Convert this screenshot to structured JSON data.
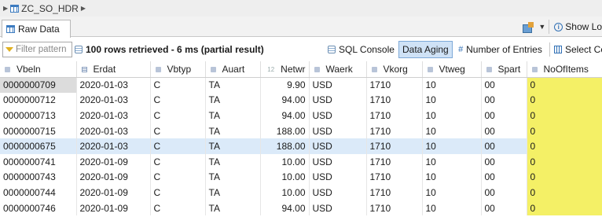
{
  "breadcrumb": {
    "table_name": "ZC_SO_HDR"
  },
  "tabs": [
    {
      "label": "Raw Data"
    }
  ],
  "topright": {
    "show_label": "Show Lo"
  },
  "toolbar": {
    "filter_placeholder": "Filter pattern",
    "status_text": "100 rows retrieved - 6 ms (partial result)",
    "sql_console": "SQL Console",
    "data_aging": "Data Aging",
    "number_of_entries": "Number of Entries",
    "select_columns": "Select Co"
  },
  "columns": [
    "Vbeln",
    "Erdat",
    "Vbtyp",
    "Auart",
    "Netwr",
    "Waerk",
    "Vkorg",
    "Vtweg",
    "Spart",
    "NoOfItems"
  ],
  "rows": [
    [
      "0000000709",
      "2020-01-03",
      "C",
      "TA",
      "9.90",
      "USD",
      "1710",
      "10",
      "00",
      "0"
    ],
    [
      "0000000712",
      "2020-01-03",
      "C",
      "TA",
      "94.00",
      "USD",
      "1710",
      "10",
      "00",
      "0"
    ],
    [
      "0000000713",
      "2020-01-03",
      "C",
      "TA",
      "94.00",
      "USD",
      "1710",
      "10",
      "00",
      "0"
    ],
    [
      "0000000715",
      "2020-01-03",
      "C",
      "TA",
      "188.00",
      "USD",
      "1710",
      "10",
      "00",
      "0"
    ],
    [
      "0000000675",
      "2020-01-03",
      "C",
      "TA",
      "188.00",
      "USD",
      "1710",
      "10",
      "00",
      "0"
    ],
    [
      "0000000741",
      "2020-01-09",
      "C",
      "TA",
      "10.00",
      "USD",
      "1710",
      "10",
      "00",
      "0"
    ],
    [
      "0000000743",
      "2020-01-09",
      "C",
      "TA",
      "10.00",
      "USD",
      "1710",
      "10",
      "00",
      "0"
    ],
    [
      "0000000744",
      "2020-01-09",
      "C",
      "TA",
      "10.00",
      "USD",
      "1710",
      "10",
      "00",
      "0"
    ],
    [
      "0000000746",
      "2020-01-09",
      "C",
      "TA",
      "94.00",
      "USD",
      "1710",
      "10",
      "00",
      "0"
    ]
  ],
  "colors": {
    "highlight": "#f4f066",
    "selected_row": "#dbeaf9",
    "active_button": "#cfe2f6"
  }
}
